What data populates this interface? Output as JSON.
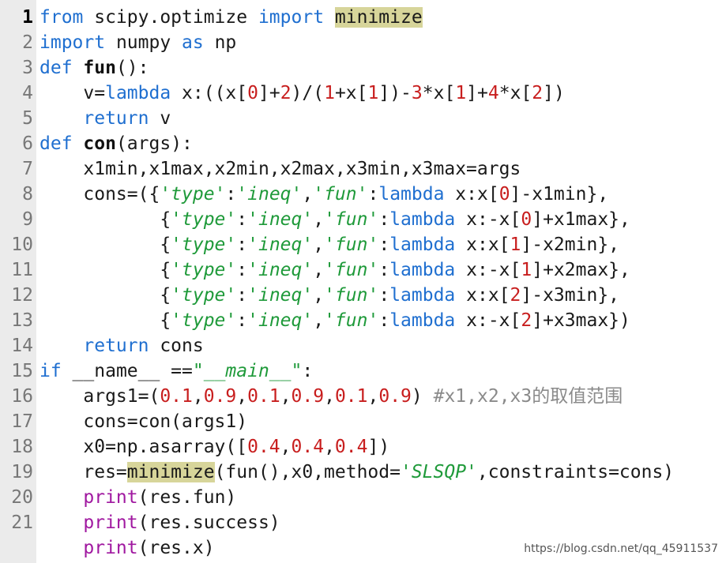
{
  "editor": {
    "line_numbers": [
      "1",
      "2",
      "3",
      "4",
      "5",
      "6",
      "7",
      "8",
      "9",
      "10",
      "11",
      "12",
      "13",
      "14",
      "15",
      "16",
      "17",
      "18",
      "19",
      "20",
      "21"
    ],
    "active_line": "1",
    "colors": {
      "keyword": "#1f6fd0",
      "number": "#c81e1e",
      "string": "#1f9a3a",
      "builtin": "#a018a0",
      "comment": "#8a8a8a",
      "highlight": "#d7d59a",
      "gutter": "#ebebeb"
    },
    "lines": [
      [
        {
          "t": "kw",
          "v": "from"
        },
        {
          "t": "",
          "v": " scipy.optimize "
        },
        {
          "t": "kw",
          "v": "import"
        },
        {
          "t": "",
          "v": " "
        },
        {
          "t": "hl",
          "v": "minimize"
        }
      ],
      [
        {
          "t": "kw",
          "v": "import"
        },
        {
          "t": "",
          "v": " numpy "
        },
        {
          "t": "kw",
          "v": "as"
        },
        {
          "t": "",
          "v": " np"
        }
      ],
      [
        {
          "t": "kw",
          "v": "def"
        },
        {
          "t": "",
          "v": " "
        },
        {
          "t": "fn",
          "v": "fun"
        },
        {
          "t": "",
          "v": "():"
        }
      ],
      [
        {
          "t": "",
          "v": "    v="
        },
        {
          "t": "kw",
          "v": "lambda"
        },
        {
          "t": "",
          "v": " x:((x["
        },
        {
          "t": "num",
          "v": "0"
        },
        {
          "t": "",
          "v": "]+"
        },
        {
          "t": "num",
          "v": "2"
        },
        {
          "t": "",
          "v": ")/("
        },
        {
          "t": "num",
          "v": "1"
        },
        {
          "t": "",
          "v": "+x["
        },
        {
          "t": "num",
          "v": "1"
        },
        {
          "t": "",
          "v": "])-"
        },
        {
          "t": "num",
          "v": "3"
        },
        {
          "t": "",
          "v": "*x["
        },
        {
          "t": "num",
          "v": "1"
        },
        {
          "t": "",
          "v": "]+"
        },
        {
          "t": "num",
          "v": "4"
        },
        {
          "t": "",
          "v": "*x["
        },
        {
          "t": "num",
          "v": "2"
        },
        {
          "t": "",
          "v": "])"
        }
      ],
      [
        {
          "t": "",
          "v": "    "
        },
        {
          "t": "kw",
          "v": "return"
        },
        {
          "t": "",
          "v": " v"
        }
      ],
      [
        {
          "t": "kw",
          "v": "def"
        },
        {
          "t": "",
          "v": " "
        },
        {
          "t": "fn",
          "v": "con"
        },
        {
          "t": "",
          "v": "(args):"
        }
      ],
      [
        {
          "t": "",
          "v": "    x1min,x1max,x2min,x2max,x3min,x3max=args"
        }
      ],
      [
        {
          "t": "",
          "v": "    cons=({"
        },
        {
          "t": "str",
          "v": "'type'"
        },
        {
          "t": "",
          "v": ":"
        },
        {
          "t": "str",
          "v": "'ineq'"
        },
        {
          "t": "",
          "v": ","
        },
        {
          "t": "str",
          "v": "'fun'"
        },
        {
          "t": "",
          "v": ":"
        },
        {
          "t": "kw",
          "v": "lambda"
        },
        {
          "t": "",
          "v": " x:x["
        },
        {
          "t": "num",
          "v": "0"
        },
        {
          "t": "",
          "v": "]-x1min},"
        }
      ],
      [
        {
          "t": "",
          "v": "           {"
        },
        {
          "t": "str",
          "v": "'type'"
        },
        {
          "t": "",
          "v": ":"
        },
        {
          "t": "str",
          "v": "'ineq'"
        },
        {
          "t": "",
          "v": ","
        },
        {
          "t": "str",
          "v": "'fun'"
        },
        {
          "t": "",
          "v": ":"
        },
        {
          "t": "kw",
          "v": "lambda"
        },
        {
          "t": "",
          "v": " x:-x["
        },
        {
          "t": "num",
          "v": "0"
        },
        {
          "t": "",
          "v": "]+x1max},"
        }
      ],
      [
        {
          "t": "",
          "v": "           {"
        },
        {
          "t": "str",
          "v": "'type'"
        },
        {
          "t": "",
          "v": ":"
        },
        {
          "t": "str",
          "v": "'ineq'"
        },
        {
          "t": "",
          "v": ","
        },
        {
          "t": "str",
          "v": "'fun'"
        },
        {
          "t": "",
          "v": ":"
        },
        {
          "t": "kw",
          "v": "lambda"
        },
        {
          "t": "",
          "v": " x:x["
        },
        {
          "t": "num",
          "v": "1"
        },
        {
          "t": "",
          "v": "]-x2min},"
        }
      ],
      [
        {
          "t": "",
          "v": "           {"
        },
        {
          "t": "str",
          "v": "'type'"
        },
        {
          "t": "",
          "v": ":"
        },
        {
          "t": "str",
          "v": "'ineq'"
        },
        {
          "t": "",
          "v": ","
        },
        {
          "t": "str",
          "v": "'fun'"
        },
        {
          "t": "",
          "v": ":"
        },
        {
          "t": "kw",
          "v": "lambda"
        },
        {
          "t": "",
          "v": " x:-x["
        },
        {
          "t": "num",
          "v": "1"
        },
        {
          "t": "",
          "v": "]+x2max},"
        }
      ],
      [
        {
          "t": "",
          "v": "           {"
        },
        {
          "t": "str",
          "v": "'type'"
        },
        {
          "t": "",
          "v": ":"
        },
        {
          "t": "str",
          "v": "'ineq'"
        },
        {
          "t": "",
          "v": ","
        },
        {
          "t": "str",
          "v": "'fun'"
        },
        {
          "t": "",
          "v": ":"
        },
        {
          "t": "kw",
          "v": "lambda"
        },
        {
          "t": "",
          "v": " x:x["
        },
        {
          "t": "num",
          "v": "2"
        },
        {
          "t": "",
          "v": "]-x3min},"
        }
      ],
      [
        {
          "t": "",
          "v": "           {"
        },
        {
          "t": "str",
          "v": "'type'"
        },
        {
          "t": "",
          "v": ":"
        },
        {
          "t": "str",
          "v": "'ineq'"
        },
        {
          "t": "",
          "v": ","
        },
        {
          "t": "str",
          "v": "'fun'"
        },
        {
          "t": "",
          "v": ":"
        },
        {
          "t": "kw",
          "v": "lambda"
        },
        {
          "t": "",
          "v": " x:-x["
        },
        {
          "t": "num",
          "v": "2"
        },
        {
          "t": "",
          "v": "]+x3max})"
        }
      ],
      [
        {
          "t": "",
          "v": "    "
        },
        {
          "t": "kw",
          "v": "return"
        },
        {
          "t": "",
          "v": " cons"
        }
      ],
      [
        {
          "t": "kw",
          "v": "if"
        },
        {
          "t": "",
          "v": " __name__ =="
        },
        {
          "t": "str",
          "v": "\"__main__\""
        },
        {
          "t": "",
          "v": ":"
        }
      ],
      [
        {
          "t": "",
          "v": "    args1=("
        },
        {
          "t": "num",
          "v": "0.1"
        },
        {
          "t": "",
          "v": ","
        },
        {
          "t": "num",
          "v": "0.9"
        },
        {
          "t": "",
          "v": ","
        },
        {
          "t": "num",
          "v": "0.1"
        },
        {
          "t": "",
          "v": ","
        },
        {
          "t": "num",
          "v": "0.9"
        },
        {
          "t": "",
          "v": ","
        },
        {
          "t": "num",
          "v": "0.1"
        },
        {
          "t": "",
          "v": ","
        },
        {
          "t": "num",
          "v": "0.9"
        },
        {
          "t": "",
          "v": ") "
        },
        {
          "t": "cm",
          "v": "#x1,x2,x3的取值范围"
        }
      ],
      [
        {
          "t": "",
          "v": "    cons=con(args1)"
        }
      ],
      [
        {
          "t": "",
          "v": "    x0=np.asarray(["
        },
        {
          "t": "num",
          "v": "0.4"
        },
        {
          "t": "",
          "v": ","
        },
        {
          "t": "num",
          "v": "0.4"
        },
        {
          "t": "",
          "v": ","
        },
        {
          "t": "num",
          "v": "0.4"
        },
        {
          "t": "",
          "v": "])"
        }
      ],
      [
        {
          "t": "",
          "v": "    res="
        },
        {
          "t": "hl",
          "v": "minimize"
        },
        {
          "t": "",
          "v": "(fun(),x0,method="
        },
        {
          "t": "str",
          "v": "'SLSQP'"
        },
        {
          "t": "",
          "v": ",constraints=cons)"
        }
      ],
      [
        {
          "t": "",
          "v": "    "
        },
        {
          "t": "pr",
          "v": "print"
        },
        {
          "t": "",
          "v": "(res.fun)"
        }
      ],
      [
        {
          "t": "",
          "v": "    "
        },
        {
          "t": "pr",
          "v": "print"
        },
        {
          "t": "",
          "v": "(res.success)"
        }
      ],
      [
        {
          "t": "",
          "v": "    "
        },
        {
          "t": "pr",
          "v": "print"
        },
        {
          "t": "",
          "v": "(res.x)"
        }
      ]
    ]
  },
  "watermark": "https://blog.csdn.net/qq_45911537"
}
